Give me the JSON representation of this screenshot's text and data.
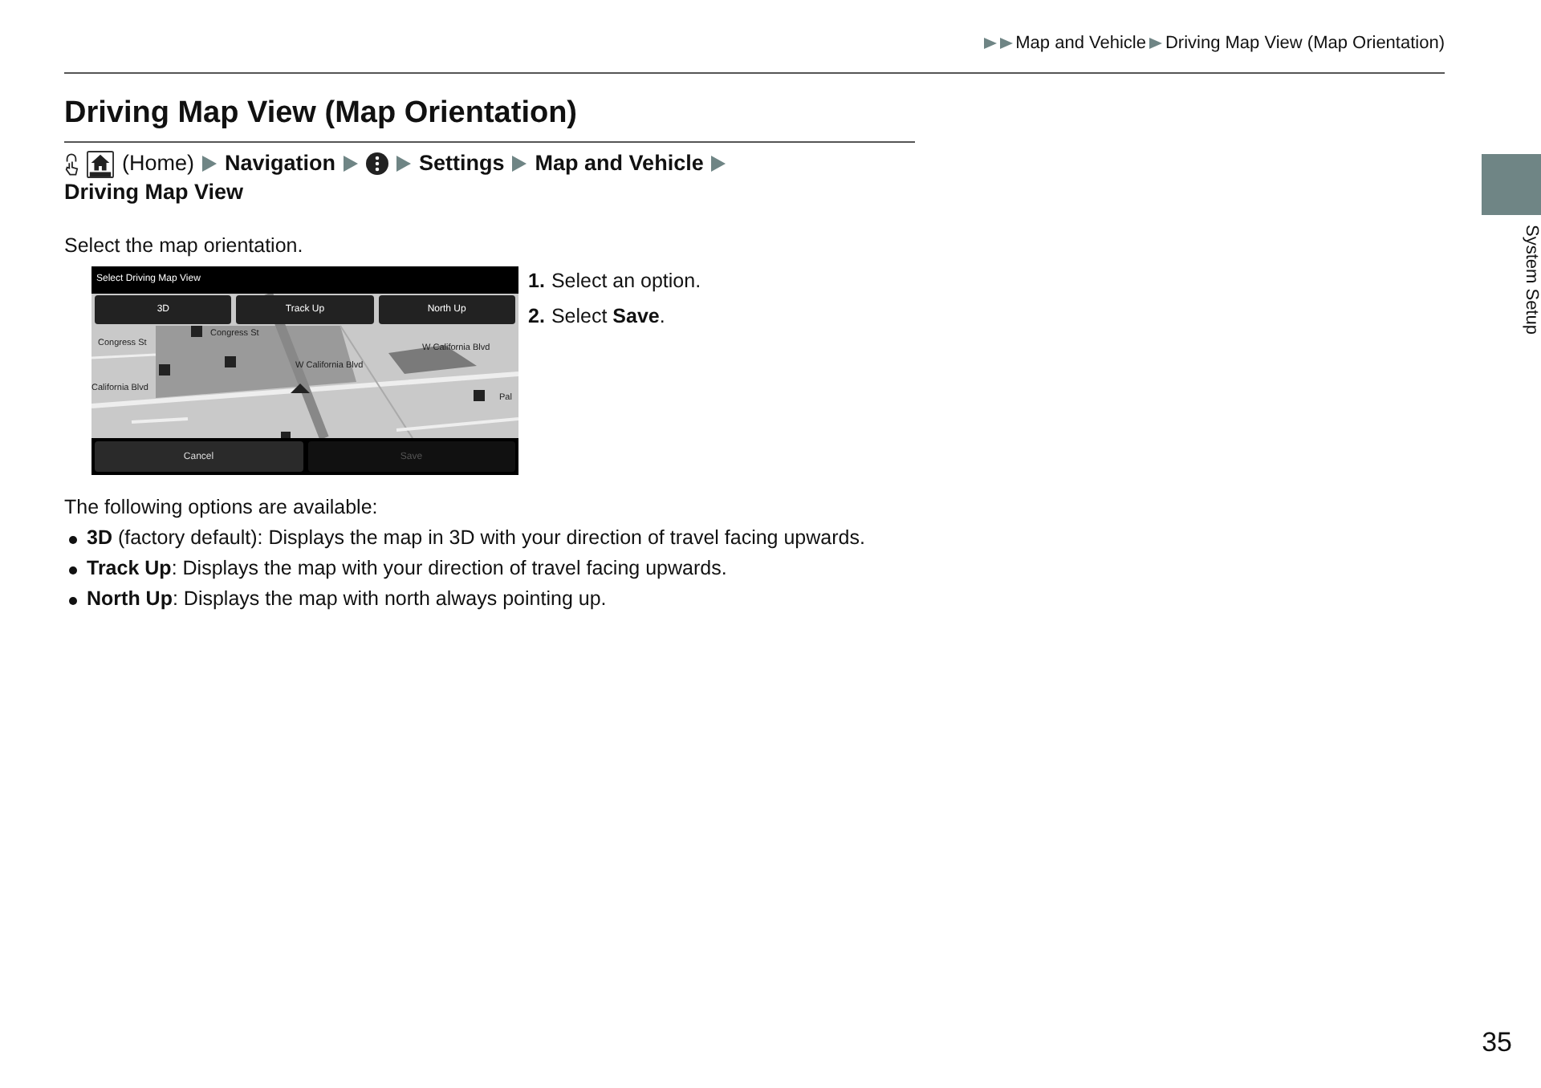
{
  "breadcrumb": [
    "Map and Vehicle",
    "Driving Map View (Map Orientation)"
  ],
  "title": "Driving Map View (Map Orientation)",
  "path": [
    {
      "kind": "home",
      "text": "(Home)"
    },
    {
      "kind": "step",
      "text": "Navigation"
    },
    {
      "kind": "menu"
    },
    {
      "kind": "step",
      "text": "Settings"
    },
    {
      "kind": "step",
      "text": "Map and Vehicle"
    },
    {
      "kind": "step",
      "text": "Driving Map View"
    }
  ],
  "intro": "Select the map orientation.",
  "screen": {
    "title": "Select Driving Map View",
    "options": [
      "3D",
      "Track Up",
      "North Up"
    ],
    "map_labels": [
      "Congress St",
      "Congress St",
      "W California Blvd",
      "W California Blvd",
      "California Blvd",
      "Pal"
    ],
    "buttons": [
      {
        "label": "Cancel",
        "disabled": false
      },
      {
        "label": "Save",
        "disabled": true
      }
    ]
  },
  "steps": [
    {
      "number": "1.",
      "text": "Select an option."
    },
    {
      "number": "2.",
      "text": "Select **Save**."
    }
  ],
  "options_intro": "The following options are available:",
  "options": [
    "**3D** (factory default): Displays the map in 3D with your direction of travel facing upwards.",
    "**Track Up**: Displays the map with your direction of travel facing upwards.",
    "**North Up**: Displays the map with north always pointing up."
  ],
  "side_tab": "System Setup",
  "page_number": "35"
}
